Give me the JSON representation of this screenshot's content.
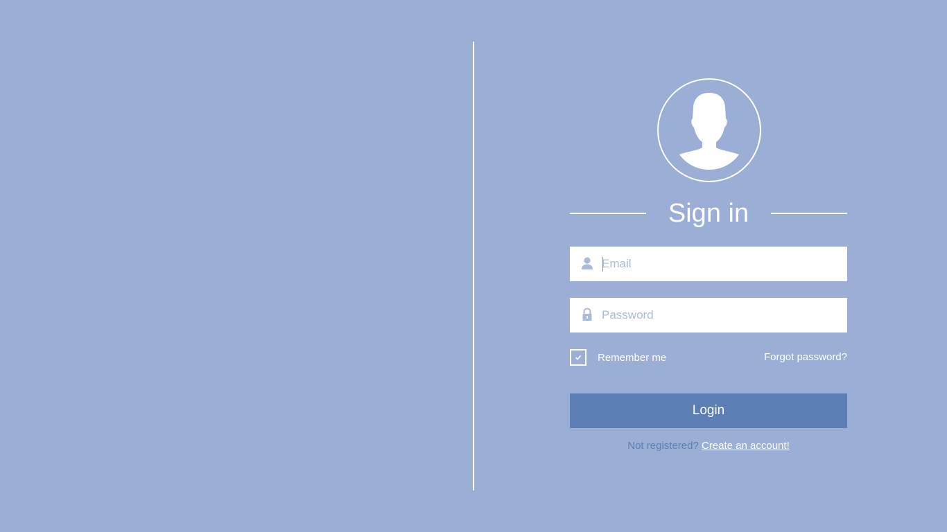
{
  "colors": {
    "background": "#9aaed6",
    "accent": "#5b7fb5",
    "foreground": "#ffffff",
    "placeholder": "#a9bcd6"
  },
  "login": {
    "title": "Sign in",
    "avatar_icon": "user-avatar-icon",
    "email": {
      "icon": "user-icon",
      "value": "",
      "placeholder": "Email"
    },
    "password": {
      "icon": "lock-icon",
      "value": "",
      "placeholder": "Password"
    },
    "remember_me": {
      "label": "Remember me",
      "checked": true
    },
    "forgot_password": "Forgot password?",
    "login_button": "Login",
    "register": {
      "prompt": "Not registered?",
      "link": "Create an account!"
    }
  }
}
